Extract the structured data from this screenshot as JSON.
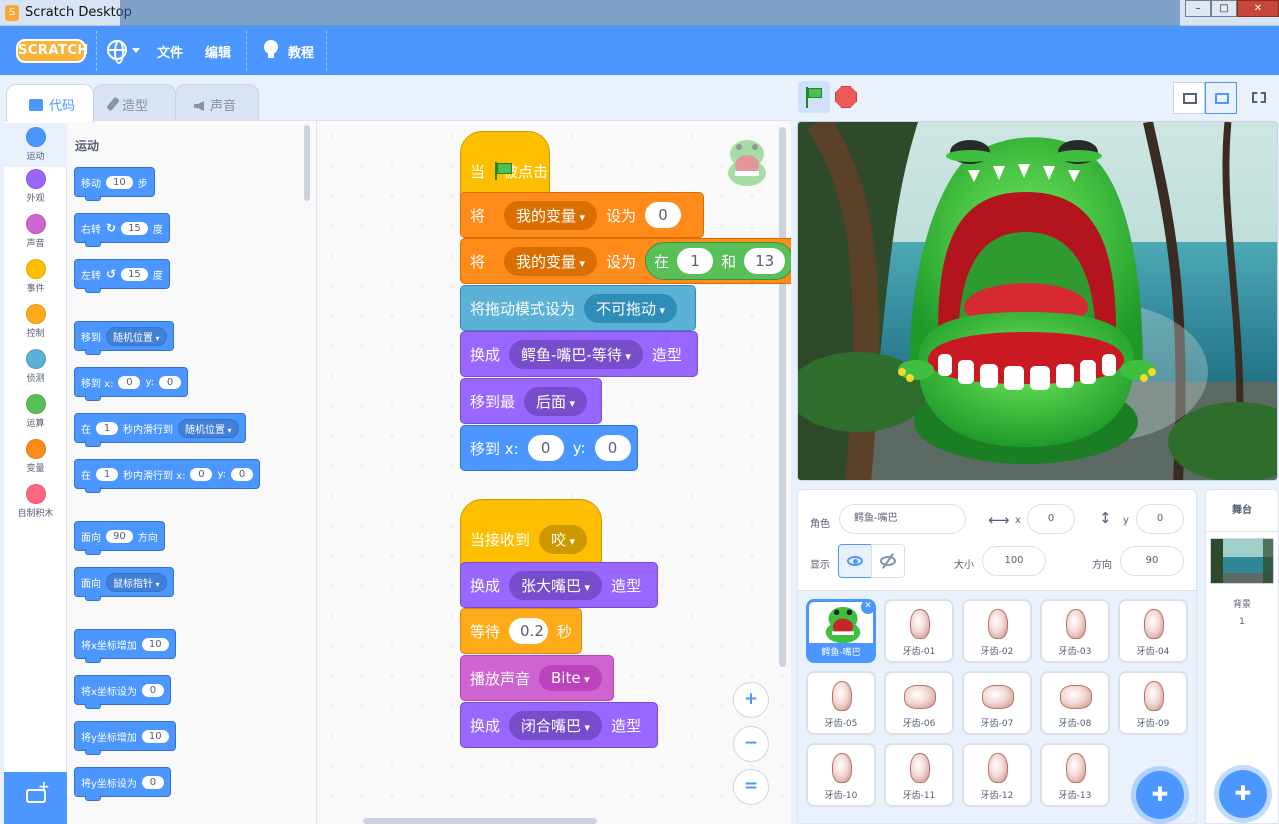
{
  "window": {
    "title": "Scratch Desktop",
    "controls": [
      "–",
      "□",
      "✕"
    ]
  },
  "menu": {
    "logo": "SCRATCH",
    "file": "文件",
    "edit": "编辑",
    "tutorials": "教程"
  },
  "tabs": {
    "code": "代码",
    "costumes": "造型",
    "sounds": "声音"
  },
  "categories": [
    {
      "label": "运动",
      "color": "#4c97ff"
    },
    {
      "label": "外观",
      "color": "#9966ff"
    },
    {
      "label": "声音",
      "color": "#cf63cf"
    },
    {
      "label": "事件",
      "color": "#ffbf00"
    },
    {
      "label": "控制",
      "color": "#ffab19"
    },
    {
      "label": "侦测",
      "color": "#5cb1d6"
    },
    {
      "label": "运算",
      "color": "#59c059"
    },
    {
      "label": "变量",
      "color": "#ff8c1a"
    },
    {
      "label": "自制积木",
      "color": "#ff6680"
    }
  ],
  "palette": {
    "title": "运动",
    "move": {
      "a": "移动",
      "v": "10",
      "b": "步"
    },
    "turn_right": {
      "a": "右转",
      "v": "15",
      "b": "度"
    },
    "turn_left": {
      "a": "左转",
      "v": "15",
      "b": "度"
    },
    "goto": {
      "a": "移到",
      "dd": "随机位置"
    },
    "goto_xy": {
      "a": "移到 x:",
      "x": "0",
      "y_label": "y:",
      "y": "0"
    },
    "glide_to": {
      "a": "在",
      "v": "1",
      "b": "秒内滑行到",
      "dd": "随机位置"
    },
    "glide_xy": {
      "a": "在",
      "v": "1",
      "b": "秒内滑行到 x:",
      "x": "0",
      "y_label": "y:",
      "y": "0"
    },
    "point_dir": {
      "a": "面向",
      "v": "90",
      "b": "方向"
    },
    "point_towards": {
      "a": "面向",
      "dd": "鼠标指针"
    },
    "change_x": {
      "a": "将x坐标增加",
      "v": "10"
    },
    "set_x": {
      "a": "将x坐标设为",
      "v": "0"
    },
    "change_y": {
      "a": "将y坐标增加",
      "v": "10"
    },
    "set_y": {
      "a": "将y坐标设为",
      "v": "0"
    }
  },
  "script1": {
    "hat": {
      "a": "当",
      "b": "被点击"
    },
    "set1": {
      "a": "将",
      "var": "我的变量",
      "b": "设为",
      "v": "0"
    },
    "set2": {
      "a": "将",
      "var": "我的变量",
      "b": "设为",
      "op_a": "在",
      "op_v1": "1",
      "op_b": "和",
      "op_v2": "13"
    },
    "drag": {
      "a": "将拖动模式设为",
      "dd": "不可拖动"
    },
    "costume1": {
      "a": "换成",
      "dd": "鳄鱼-嘴巴-等待",
      "b": "造型"
    },
    "layer": {
      "a": "移到最",
      "dd": "后面"
    },
    "goto": {
      "a": "移到 x:",
      "x": "0",
      "y_label": "y:",
      "y": "0"
    }
  },
  "script2": {
    "hat": {
      "a": "当接收到",
      "dd": "咬"
    },
    "costume2": {
      "a": "换成",
      "dd": "张大嘴巴",
      "b": "造型"
    },
    "wait": {
      "a": "等待",
      "v": "0.2",
      "b": "秒"
    },
    "sound": {
      "a": "播放声音",
      "dd": "Bite"
    },
    "costume3": {
      "a": "换成",
      "dd": "闭合嘴巴",
      "b": "造型"
    }
  },
  "zoom": {
    "in": "+",
    "out": "−",
    "reset": "="
  },
  "sprite_info": {
    "sprite_label": "角色",
    "sprite_name": "鳄鱼-嘴巴",
    "x_label": "x",
    "x": "0",
    "y_label": "y",
    "y": "0",
    "show_label": "显示",
    "size_label": "大小",
    "size": "100",
    "direction_label": "方向",
    "direction": "90"
  },
  "sprites": [
    "鳄鱼-嘴巴",
    "牙齿-01",
    "牙齿-02",
    "牙齿-03",
    "牙齿-04",
    "牙齿-05",
    "牙齿-06",
    "牙齿-07",
    "牙齿-08",
    "牙齿-09",
    "牙齿-10",
    "牙齿-11",
    "牙齿-12",
    "牙齿-13"
  ],
  "stage_pane": {
    "title": "舞台",
    "backdrop_label": "背景",
    "backdrop_count": "1"
  }
}
